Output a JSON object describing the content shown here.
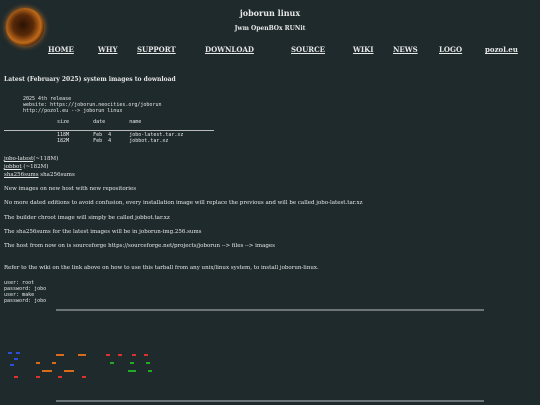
{
  "site": {
    "title": "joborun linux",
    "subtitle": "Jwm OpenBOx RUNit"
  },
  "nav": {
    "home": "HOME",
    "why": "WHY",
    "support": "SUPPORT",
    "download": "DOWNLOAD",
    "source": "SOURCE",
    "wiki": "WIKI",
    "news": "NEWS",
    "logo": "LOGO",
    "pozol": "pozol.eu"
  },
  "main": {
    "heading": "Latest (February 2025) system images to download",
    "release_info": "2025 4th release\nwebsite: https://joborun.neocities.org/joborun\nhttp://pozol.eu --> joborun linux",
    "table_header": "size        date        name",
    "table_rows": "118M        Feb  4      jobo-latest.tar.xz\n182M        Feb  4      jobbot.tar.xz",
    "links": {
      "jobo_latest": "jobo-latest",
      "jobo_latest_size": "(~118M)",
      "jobbot": "jobbot",
      "jobbot_size": "(~182M)",
      "sha": "sha256sums",
      "sha_plain": "sha256sums"
    },
    "paragraphs": {
      "p1": "New images on new host with new repositories",
      "p2": "No more dated editions to avoid confusion, every installation image will replace the previous and will be called jobo-latest.tar.xz",
      "p3": "The builder chroot image will simply be called jobbot.tar.xz",
      "p4": "The sha256sums for the latest images will be in joborun-img.256.sums",
      "p5": "The host from now on is sourceforge https://sourceforge.net/projects/joborun --> files --> images",
      "p6": "Refer to the wiki on the link above on how to use this tarball from any unix/linux system, to install joborun-linux."
    },
    "credentials": "user: root\npassword: jobo\nuser: make\npassword: jobo"
  },
  "colors": {
    "background": "#1f2a2d",
    "text": "#e8e8e8",
    "logo_orange": "#c9731f",
    "ascii_blue": "#2b4fd8",
    "ascii_orange": "#d86a1c",
    "ascii_red": "#e03030",
    "ascii_green": "#22aa22"
  }
}
